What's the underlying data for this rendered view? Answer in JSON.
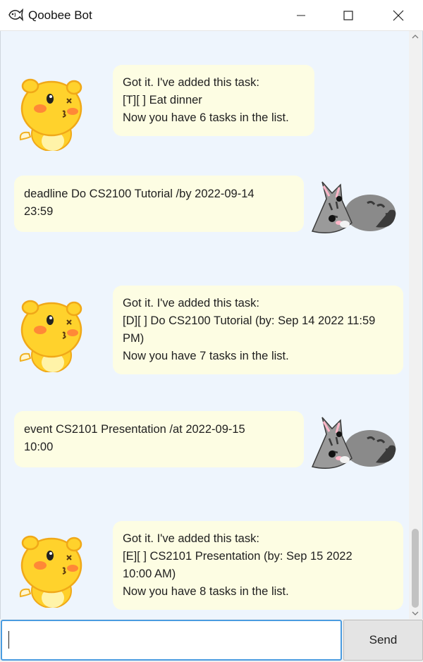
{
  "window": {
    "title": "Qoobee Bot",
    "controls": [
      "minimize",
      "maximize",
      "close"
    ]
  },
  "messages": [
    {
      "sender": "bot",
      "avatar": "qoobee-avatar",
      "lines": [
        "Got it. I've added this task:",
        "[T][ ] Eat dinner",
        "Now you have 6 tasks in the list."
      ]
    },
    {
      "sender": "user",
      "avatar": "cat-avatar",
      "lines": [
        "deadline Do CS2100 Tutorial /by 2022-09-14",
        "23:59"
      ]
    },
    {
      "sender": "bot",
      "avatar": "qoobee-avatar",
      "lines": [
        "Got it. I've added this task:",
        "[D][ ] Do CS2100 Tutorial (by: Sep 14 2022 11:59",
        "PM)",
        "Now you have 7 tasks in the list."
      ]
    },
    {
      "sender": "user",
      "avatar": "cat-avatar",
      "lines": [
        "event CS2101 Presentation /at 2022-09-15",
        "10:00"
      ]
    },
    {
      "sender": "bot",
      "avatar": "qoobee-avatar",
      "lines": [
        "Got it. I've added this task:",
        "[E][ ] CS2101 Presentation (by: Sep 15 2022",
        "10:00 AM)",
        "Now you have 8 tasks in the list."
      ]
    }
  ],
  "input": {
    "value": "",
    "placeholder": ""
  },
  "send_button": {
    "label": "Send"
  },
  "colors": {
    "chat_background": "#eef5fd",
    "bubble": "#fdfde3",
    "input_focus_border": "#4a9ce0",
    "send_button": "#e4e4e4"
  },
  "icons": {
    "app": "fish-icon",
    "scroll_up": "chevron-up-icon",
    "scroll_down": "chevron-down-icon"
  }
}
